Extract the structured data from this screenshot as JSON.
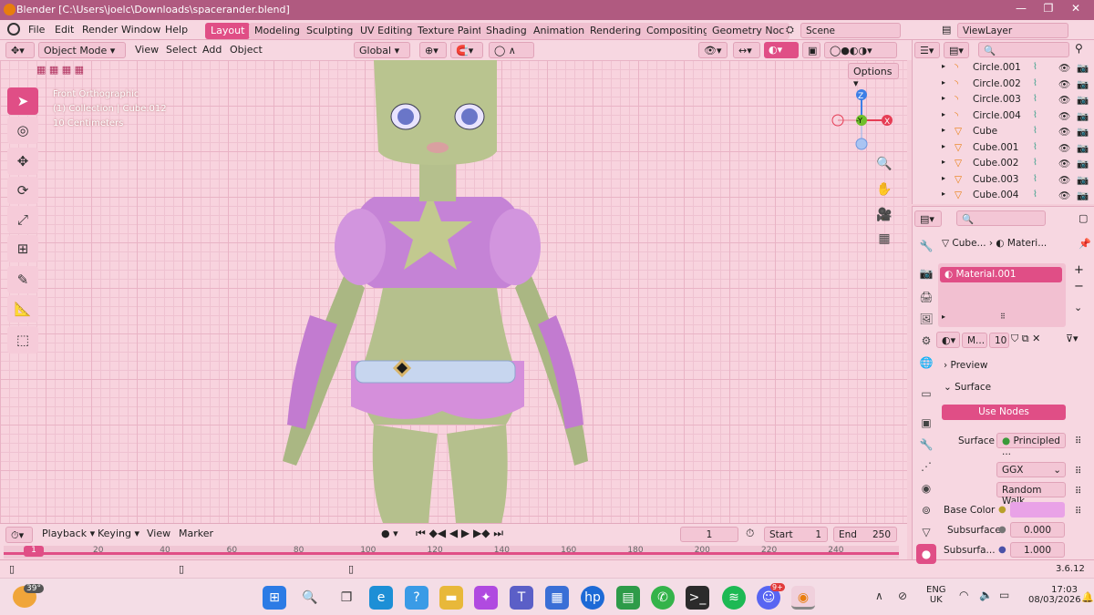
{
  "window": {
    "title": "Blender [C:\\Users\\joelc\\Downloads\\spacerander.blend]",
    "min": "—",
    "max": "❐",
    "close": "✕"
  },
  "menu": [
    "File",
    "Edit",
    "Render",
    "Window",
    "Help"
  ],
  "workspaces": [
    "Layout",
    "Modeling",
    "Sculpting",
    "UV Editing",
    "Texture Paint",
    "Shading",
    "Animation",
    "Rendering",
    "Compositing",
    "Geometry Noc"
  ],
  "scene": "Scene",
  "view_layer": "ViewLayer",
  "header": {
    "mode": "Object Mode",
    "view": "View",
    "select": "Select",
    "add": "Add",
    "object": "Object",
    "transform": "Global",
    "options": "Options"
  },
  "viewport": {
    "view_name": "Front Orthographic",
    "collection": "(1) Collection | Cube.012",
    "scale": "10 Centimeters"
  },
  "gizmo": {
    "z": "Z",
    "y": "-Y",
    "x": "X"
  },
  "outliner": {
    "items": [
      {
        "name": "Circle.001",
        "icon": "curve-icon"
      },
      {
        "name": "Circle.002",
        "icon": "curve-icon"
      },
      {
        "name": "Circle.003",
        "icon": "curve-icon"
      },
      {
        "name": "Circle.004",
        "icon": "curve-icon"
      },
      {
        "name": "Cube",
        "icon": "mesh-icon"
      },
      {
        "name": "Cube.001",
        "icon": "mesh-icon"
      },
      {
        "name": "Cube.002",
        "icon": "mesh-icon"
      },
      {
        "name": "Cube.003",
        "icon": "mesh-icon"
      },
      {
        "name": "Cube.004",
        "icon": "mesh-icon"
      }
    ]
  },
  "properties": {
    "breadcrumb_object": "Cube...",
    "breadcrumb_material": "Materi...",
    "material_slot": "Material.001",
    "material_short": "M...",
    "users": "10",
    "preview": "Preview",
    "surface": "Surface",
    "use_nodes": "Use Nodes",
    "surface_label": "Surface",
    "surface_value": "Principled ...",
    "distribution": "GGX",
    "subsurface_method": "Random Walk",
    "base_color_label": "Base Color",
    "base_color": "#e9a2e7",
    "subsurface_label": "Subsurface",
    "subsurface_value": "0.000",
    "subsurface2_label": "Subsurfa...",
    "subsurface2_value": "1.000"
  },
  "timeline": {
    "playback": "Playback",
    "keying": "Keying",
    "view": "View",
    "marker": "Marker",
    "frame": "1",
    "start_label": "Start",
    "start": "1",
    "end_label": "End",
    "end": "250",
    "ticks": [
      "20",
      "40",
      "60",
      "80",
      "100",
      "120",
      "140",
      "160",
      "180",
      "200",
      "220",
      "240"
    ]
  },
  "status": {
    "version": "3.6.12"
  },
  "taskbar": {
    "weather": "39°",
    "lang1": "ENG",
    "lang2": "UK",
    "time": "17:03",
    "date": "08/03/2026",
    "discord_badge": "9+"
  },
  "colors": {
    "accent": "#e04e86",
    "panel": "#f7d7e1"
  }
}
